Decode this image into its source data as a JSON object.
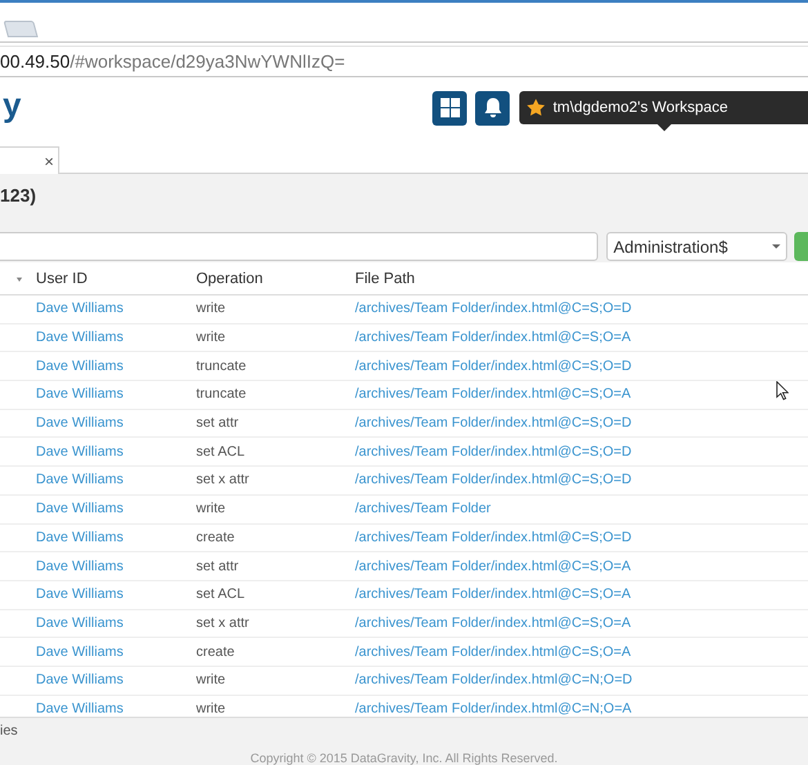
{
  "browser": {
    "url_host": "00.49.50",
    "url_path": "/#workspace/d29ya3NwYWNlIzQ="
  },
  "header": {
    "logo": "y",
    "workspace": "tm\\dgdemo2's Workspace"
  },
  "tab": {
    "close": "×"
  },
  "title": "123)",
  "filter": {
    "share": "Administration$"
  },
  "table": {
    "columns": [
      "User ID",
      "Operation",
      "File Path"
    ],
    "rows": [
      {
        "user": "Dave Williams",
        "operation": "write",
        "path": "/archives/Team Folder/index.html@C=S;O=D"
      },
      {
        "user": "Dave Williams",
        "operation": "write",
        "path": "/archives/Team Folder/index.html@C=S;O=A"
      },
      {
        "user": "Dave Williams",
        "operation": "truncate",
        "path": "/archives/Team Folder/index.html@C=S;O=D"
      },
      {
        "user": "Dave Williams",
        "operation": "truncate",
        "path": "/archives/Team Folder/index.html@C=S;O=A"
      },
      {
        "user": "Dave Williams",
        "operation": "set attr",
        "path": "/archives/Team Folder/index.html@C=S;O=D"
      },
      {
        "user": "Dave Williams",
        "operation": "set ACL",
        "path": "/archives/Team Folder/index.html@C=S;O=D"
      },
      {
        "user": "Dave Williams",
        "operation": "set x attr",
        "path": "/archives/Team Folder/index.html@C=S;O=D"
      },
      {
        "user": "Dave Williams",
        "operation": "write",
        "path": "/archives/Team Folder"
      },
      {
        "user": "Dave Williams",
        "operation": "create",
        "path": "/archives/Team Folder/index.html@C=S;O=D"
      },
      {
        "user": "Dave Williams",
        "operation": "set attr",
        "path": "/archives/Team Folder/index.html@C=S;O=A"
      },
      {
        "user": "Dave Williams",
        "operation": "set ACL",
        "path": "/archives/Team Folder/index.html@C=S;O=A"
      },
      {
        "user": "Dave Williams",
        "operation": "set x attr",
        "path": "/archives/Team Folder/index.html@C=S;O=A"
      },
      {
        "user": "Dave Williams",
        "operation": "create",
        "path": "/archives/Team Folder/index.html@C=S;O=A"
      },
      {
        "user": "Dave Williams",
        "operation": "write",
        "path": "/archives/Team Folder/index.html@C=N;O=D"
      },
      {
        "user": "Dave Williams",
        "operation": "write",
        "path": "/archives/Team Folder/index.html@C=N;O=A"
      }
    ]
  },
  "footer": {
    "entries": "ies",
    "copyright": "Copyright © 2015 DataGravity, Inc. All Rights Reserved."
  }
}
